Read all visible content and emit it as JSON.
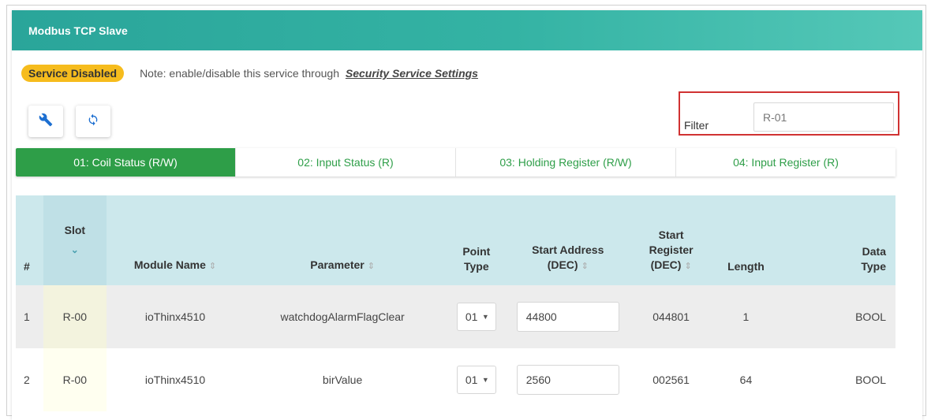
{
  "panel": {
    "title": "Modbus TCP Slave"
  },
  "status": {
    "badge": "Service Disabled",
    "note": "Note: enable/disable this service through",
    "link": "Security Service Settings"
  },
  "toolbar": {
    "settings_icon": "wrench-icon",
    "refresh_icon": "refresh-icon"
  },
  "filter": {
    "label": "Filter",
    "value": "R-01"
  },
  "tabs": [
    {
      "label": "01: Coil Status (R/W)",
      "active": true
    },
    {
      "label": "02: Input Status (R)",
      "active": false
    },
    {
      "label": "03: Holding Register (R/W)",
      "active": false
    },
    {
      "label": "04: Input Register (R)",
      "active": false
    }
  ],
  "table": {
    "headers": {
      "index": "#",
      "slot": "Slot",
      "module": "Module Name",
      "parameter": "Parameter",
      "point_type_1": "Point",
      "point_type_2": "Type",
      "start_address_1": "Start Address",
      "start_address_2": "(DEC)",
      "start_register_1": "Start",
      "start_register_2": "Register",
      "start_register_3": "(DEC)",
      "length": "Length",
      "data_type_1": "Data",
      "data_type_2": "Type"
    },
    "rows": [
      {
        "index": "1",
        "slot": "R-00",
        "module": "ioThinx4510",
        "parameter": "watchdogAlarmFlagClear",
        "point_type": "01",
        "start_address": "44800",
        "start_register": "044801",
        "length": "1",
        "data_type": "BOOL"
      },
      {
        "index": "2",
        "slot": "R-00",
        "module": "ioThinx4510",
        "parameter": "birValue",
        "point_type": "01",
        "start_address": "2560",
        "start_register": "002561",
        "length": "64",
        "data_type": "BOOL"
      }
    ]
  },
  "colors": {
    "header": "#2aa59a",
    "active_tab": "#2e9e48",
    "badge": "#f6bc1d",
    "filter_highlight": "#d03232"
  }
}
